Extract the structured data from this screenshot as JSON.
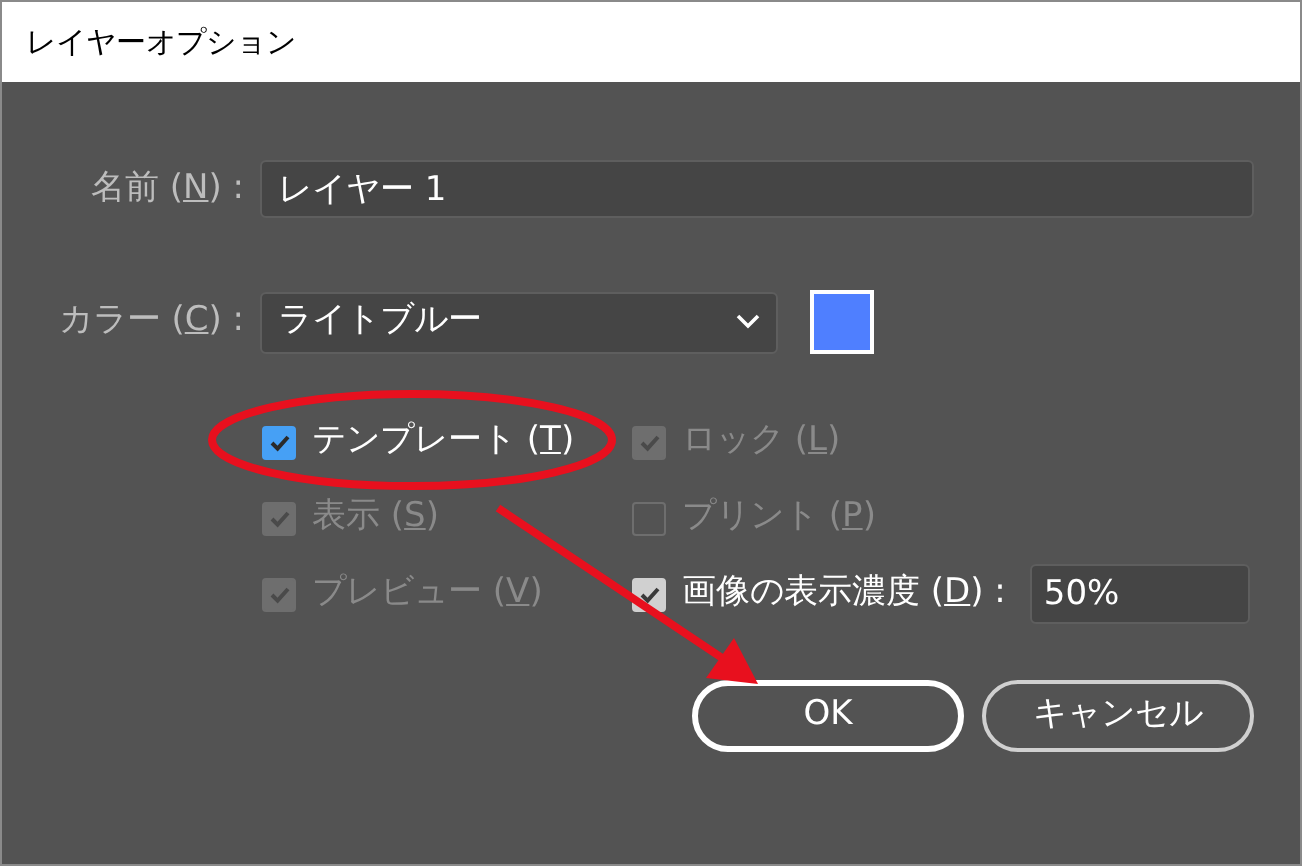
{
  "window": {
    "title": "レイヤーオプション"
  },
  "name_field": {
    "label": {
      "before": "名前 (",
      "mnemonic": "N",
      "after": ") :"
    },
    "value": "レイヤー 1"
  },
  "color_field": {
    "label": {
      "before": "カラー (",
      "mnemonic": "C",
      "after": ") :"
    },
    "value": "ライトブルー",
    "color": "#4f7fff"
  },
  "checkboxes": [
    {
      "label": {
        "before": "テンプレート (",
        "mnemonic": "T",
        "after": ")"
      },
      "checked": true,
      "disabled": false,
      "kind": "accent"
    },
    {
      "label": {
        "before": "ロック (",
        "mnemonic": "L",
        "after": ")"
      },
      "checked": true,
      "disabled": true,
      "kind": "plain"
    },
    {
      "label": {
        "before": "表示 (",
        "mnemonic": "S",
        "after": ")"
      },
      "checked": true,
      "disabled": true,
      "kind": "plain"
    },
    {
      "label": {
        "before": "プリント (",
        "mnemonic": "P",
        "after": ")"
      },
      "checked": false,
      "disabled": true,
      "kind": "plain"
    },
    {
      "label": {
        "before": "プレビュー (",
        "mnemonic": "V",
        "after": ")"
      },
      "checked": true,
      "disabled": true,
      "kind": "plain"
    },
    {
      "label": {
        "before": "画像の表示濃度 (",
        "mnemonic": "D",
        "after": ") :"
      },
      "checked": true,
      "disabled": false,
      "kind": "plain",
      "value": "50%"
    }
  ],
  "buttons": [
    {
      "label": "OK",
      "default": true
    },
    {
      "label": "キャンセル",
      "default": false
    }
  ]
}
